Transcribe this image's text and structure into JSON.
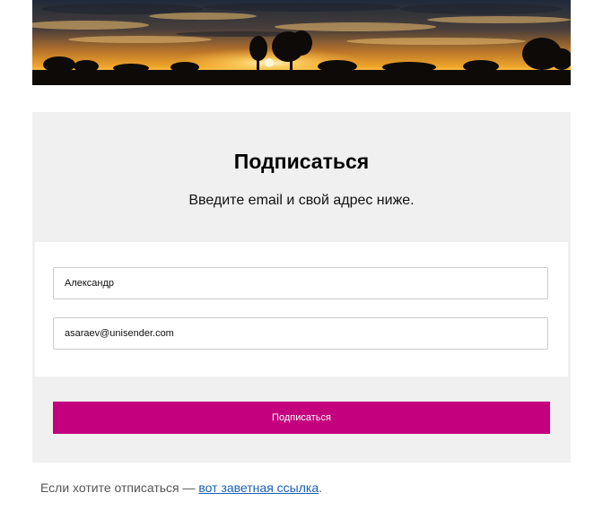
{
  "hero": {
    "image": "sunset-landscape-with-trees"
  },
  "subscribe": {
    "title": "Подписаться",
    "subtitle": "Введите email и свой адрес ниже.",
    "name_value": "Александр",
    "email_value": "asaraev@unisender.com",
    "submit_label": "Подписаться",
    "button_color": "#c5007e",
    "background_color": "#f0f0f0"
  },
  "footer": {
    "text": "Если хотите отписаться — ",
    "link_text": "вот заветная ссылка",
    "trailing": ".",
    "link_color": "#1a5fb4"
  }
}
